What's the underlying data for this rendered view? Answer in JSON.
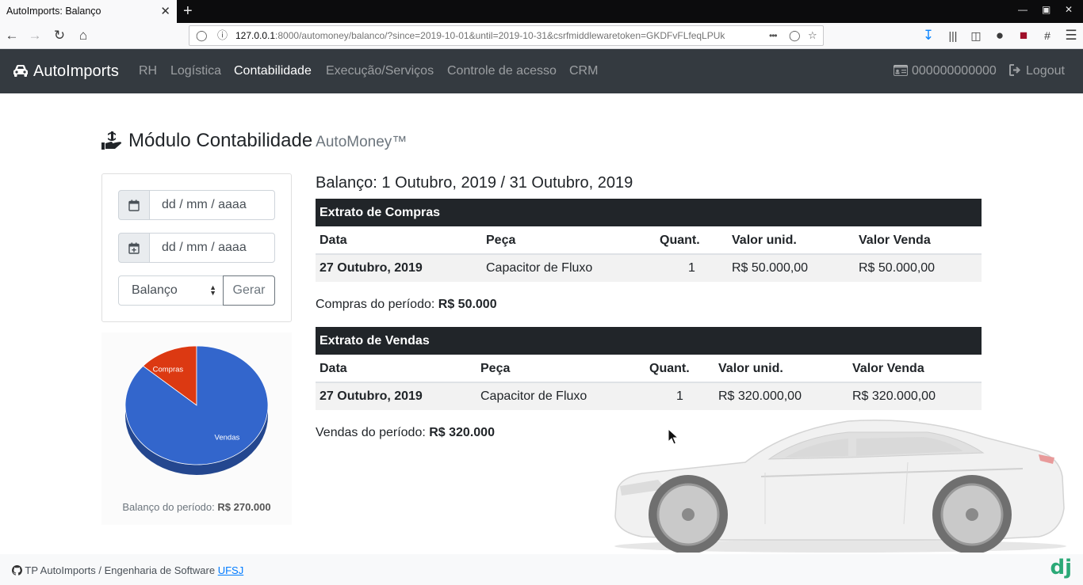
{
  "browser": {
    "tab_title": "AutoImports: Balanço",
    "tab_close": "✕",
    "new_tab": "+",
    "url_host": "127.0.0.1",
    "url_rest": ":8000/automoney/balanco/?since=2019-10-01&until=2019-10-31&csrfmiddlewaretoken=GKDFvFLfeqLPUk",
    "url_more": "•••"
  },
  "nav": {
    "brand": "AutoImports",
    "links": [
      "RH",
      "Logística",
      "Contabilidade",
      "Execução/Serviços",
      "Controle de acesso",
      "CRM"
    ],
    "active": "Contabilidade",
    "user_id": "000000000000",
    "logout": "Logout"
  },
  "page": {
    "title": "Módulo Contabilidade",
    "subtitle": "AutoMoney™"
  },
  "form": {
    "since_placeholder": "dd / mm / aaaa",
    "until_placeholder": "dd / mm / aaaa",
    "report_type": "Balanço",
    "generate_label": "Gerar"
  },
  "chart_data": {
    "type": "pie",
    "categories": [
      "Compras",
      "Vendas"
    ],
    "values": [
      50000,
      320000
    ],
    "colors": [
      "#dc3912",
      "#3366cc"
    ]
  },
  "chart_caption": {
    "label": "Balanço do período:",
    "value": "R$ 270.000"
  },
  "balance_title": "Balanço: 1 Outubro, 2019 / 31 Outubro, 2019",
  "purchases": {
    "title": "Extrato de Compras",
    "columns": [
      "Data",
      "Peça",
      "Quant.",
      "Valor unid.",
      "Valor Venda"
    ],
    "rows": [
      [
        "27 Outubro, 2019",
        "Capacitor de Fluxo",
        "1",
        "R$ 50.000,00",
        "R$ 50.000,00"
      ]
    ],
    "total_label": "Compras do período:",
    "total_value": "R$ 50.000"
  },
  "sales": {
    "title": "Extrato de Vendas",
    "columns": [
      "Data",
      "Peça",
      "Quant.",
      "Valor unid.",
      "Valor Venda"
    ],
    "rows": [
      [
        "27 Outubro, 2019",
        "Capacitor de Fluxo",
        "1",
        "R$ 320.000,00",
        "R$ 320.000,00"
      ]
    ],
    "total_label": "Vendas do período:",
    "total_value": "R$ 320.000"
  },
  "footer": {
    "text": "TP AutoImports / Engenharia de Software",
    "link": "UFSJ",
    "logo": "dj"
  }
}
